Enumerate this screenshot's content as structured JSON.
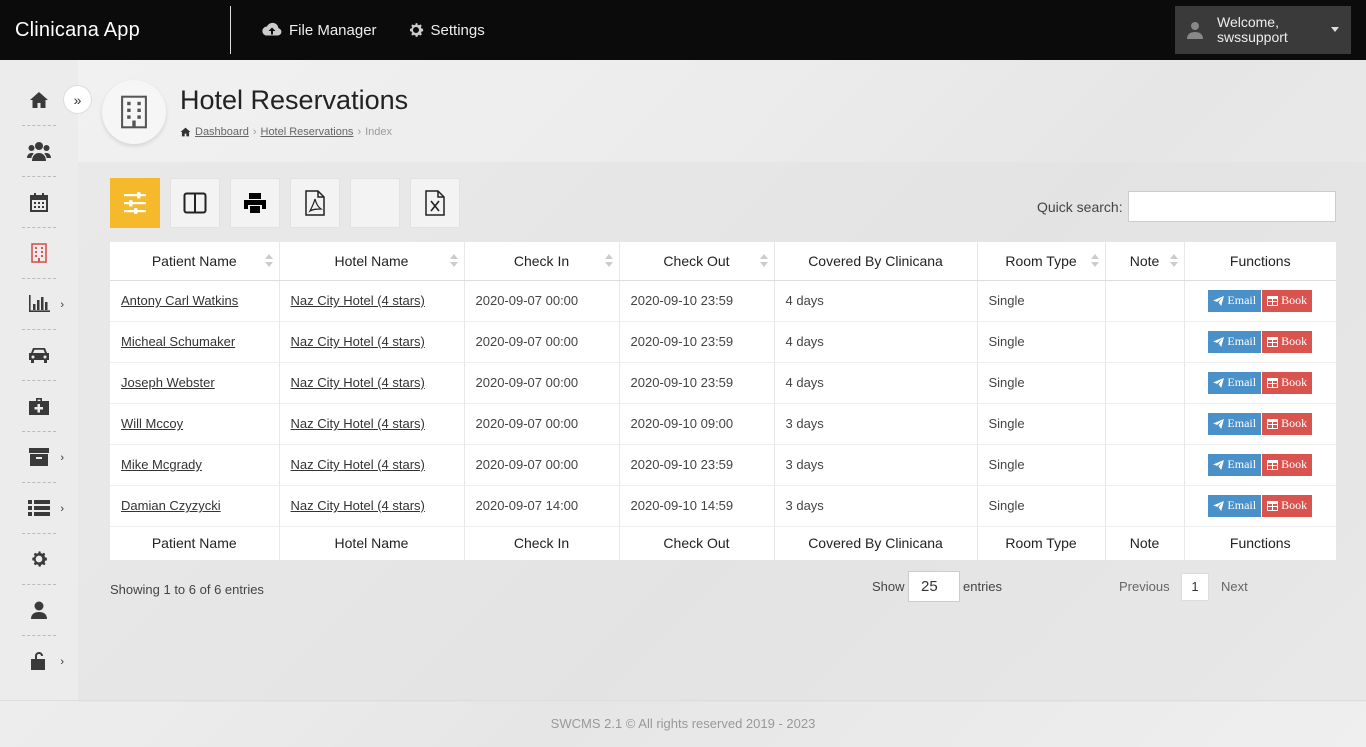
{
  "app": {
    "title": "Clinicana App"
  },
  "topnav": {
    "file_manager": "File Manager",
    "settings": "Settings"
  },
  "user": {
    "welcome": "Welcome,",
    "name": "swssupport"
  },
  "page": {
    "title": "Hotel Reservations"
  },
  "breadcrumb": {
    "dashboard": "Dashboard",
    "hotel_reservations": "Hotel Reservations",
    "current": "Index",
    "separator": "›"
  },
  "search": {
    "label": "Quick search:",
    "value": ""
  },
  "table": {
    "headers": [
      "Patient Name",
      "Hotel Name",
      "Check In",
      "Check Out",
      "Covered By Clinicana",
      "Room Type",
      "Note",
      "Functions"
    ],
    "rows": [
      {
        "patient": "Antony Carl Watkins",
        "hotel": "Naz City Hotel (4 stars)",
        "check_in": "2020-09-07 00:00",
        "check_out": "2020-09-10 23:59",
        "covered": "4 days",
        "room": "Single",
        "note": ""
      },
      {
        "patient": "Micheal Schumaker",
        "hotel": "Naz City Hotel (4 stars)",
        "check_in": "2020-09-07 00:00",
        "check_out": "2020-09-10 23:59",
        "covered": "4 days",
        "room": "Single",
        "note": ""
      },
      {
        "patient": "Joseph Webster",
        "hotel": "Naz City Hotel (4 stars)",
        "check_in": "2020-09-07 00:00",
        "check_out": "2020-09-10 23:59",
        "covered": "4 days",
        "room": "Single",
        "note": ""
      },
      {
        "patient": "Will Mccoy",
        "hotel": "Naz City Hotel (4 stars)",
        "check_in": "2020-09-07 00:00",
        "check_out": "2020-09-10 09:00",
        "covered": "3 days",
        "room": "Single",
        "note": ""
      },
      {
        "patient": "Mike Mcgrady",
        "hotel": "Naz City Hotel (4 stars)",
        "check_in": "2020-09-07 00:00",
        "check_out": "2020-09-10 23:59",
        "covered": "3 days",
        "room": "Single",
        "note": ""
      },
      {
        "patient": "Damian Czyzycki",
        "hotel": "Naz City Hotel (4 stars)",
        "check_in": "2020-09-07 14:00",
        "check_out": "2020-09-10 14:59",
        "covered": "3 days",
        "room": "Single",
        "note": ""
      }
    ],
    "email_label": "Email",
    "book_label": "Book"
  },
  "listing": {
    "showing": "Showing 1 to 6 of 6 entries",
    "show_label": "Show",
    "page_size": "25",
    "entries_label": "entries",
    "previous": "Previous",
    "page": "1",
    "next": "Next"
  },
  "footer": {
    "copyright": "SWCMS 2.1 © All rights reserved 2019 - 2023"
  },
  "colors": {
    "accent": "#f6b92b",
    "email": "#4a90c9",
    "book": "#d9534f",
    "topbar": "#0b0b0b"
  }
}
